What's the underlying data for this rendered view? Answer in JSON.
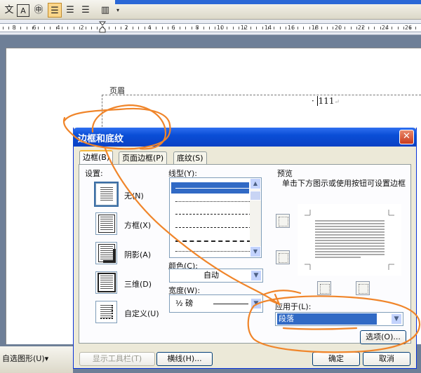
{
  "toolbar": {
    "buttons": [
      {
        "name": "phonetic-guide-icon",
        "glyph": "文"
      },
      {
        "name": "character-border-icon",
        "glyph": "A"
      },
      {
        "name": "enclose-characters-icon",
        "glyph": "㊥"
      },
      {
        "name": "align-left-icon",
        "glyph": "☰"
      },
      {
        "name": "center-align-icon",
        "glyph": "☰"
      },
      {
        "name": "justify-icon",
        "glyph": "☰"
      },
      {
        "name": "columns-icon",
        "glyph": "▥"
      }
    ]
  },
  "ruler": {
    "labels": [
      "8",
      "6",
      "4",
      "2",
      "2",
      "4",
      "6",
      "8",
      "10",
      "12",
      "14",
      "16",
      "18",
      "20",
      "22",
      "24",
      "26",
      "28",
      "30"
    ]
  },
  "document": {
    "header_label": "页眉",
    "header_text": "111"
  },
  "dialog": {
    "title": "边框和底纹",
    "close_glyph": "✕",
    "tabs": [
      {
        "label": "边框(B)",
        "selected": true
      },
      {
        "label": "页面边框(P)",
        "selected": false
      },
      {
        "label": "底纹(S)",
        "selected": false
      }
    ],
    "settings_label": "设置:",
    "settings": [
      {
        "label": "无(N)",
        "name": "setting-none"
      },
      {
        "label": "方框(X)",
        "name": "setting-box"
      },
      {
        "label": "阴影(A)",
        "name": "setting-shadow"
      },
      {
        "label": "三维(D)",
        "name": "setting-3d"
      },
      {
        "label": "自定义(U)",
        "name": "setting-custom"
      }
    ],
    "line_style_label": "线型(Y):",
    "color_label": "颜色(C):",
    "color_value": "自动",
    "width_label": "宽度(W):",
    "width_value": "½ 磅",
    "preview_label": "预览",
    "preview_hint": "单击下方图示或使用按钮可设置边框",
    "apply_to_label": "应用于(L):",
    "apply_to_value": "段落",
    "options_button": "选项(O)...",
    "show_toolbar_button": "显示工具栏(T)",
    "horizontal_line_button": "横线(H)...",
    "ok_button": "确定",
    "cancel_button": "取消"
  },
  "bottom_toolbar": {
    "autoshapes": "自选图形(U)▾"
  },
  "colors": {
    "title_bar": "#0a4ed6",
    "annotation": "#f0852a",
    "selection": "#316ac5"
  }
}
